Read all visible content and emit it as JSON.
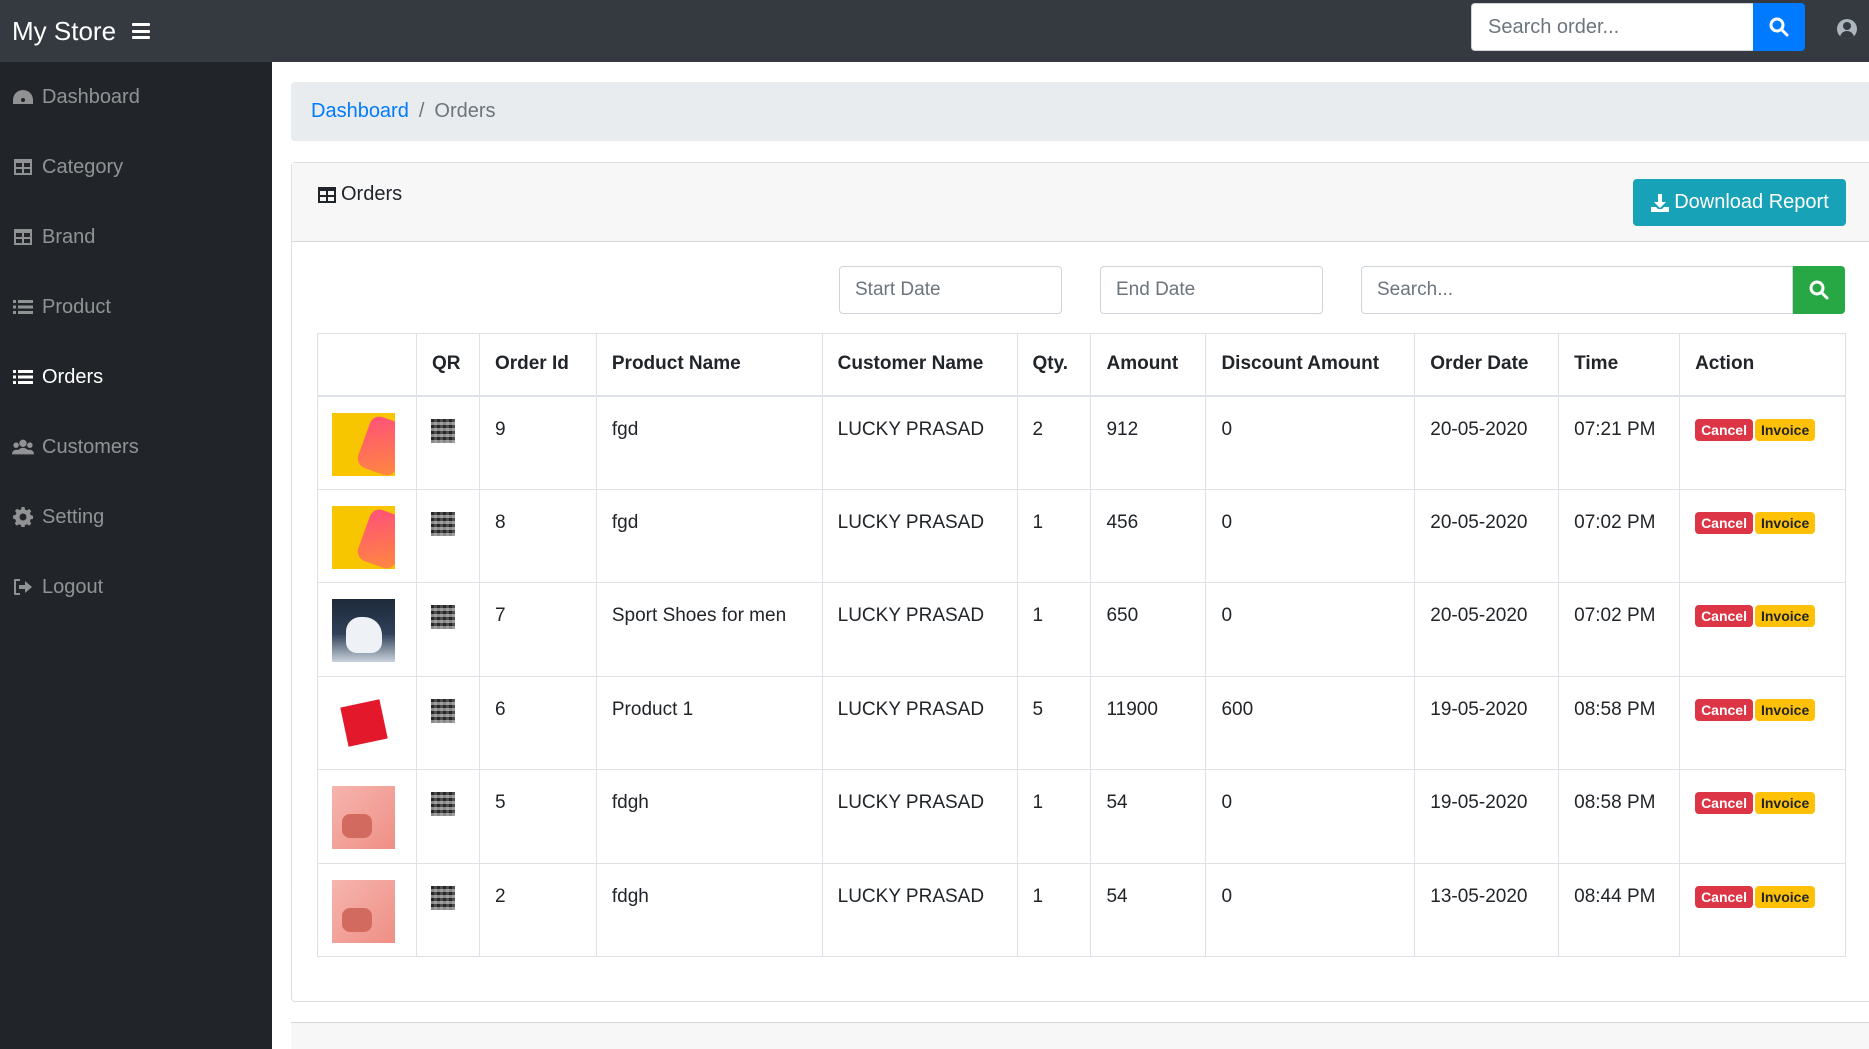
{
  "navbar": {
    "brand": "My Store",
    "search_placeholder": "Search order..."
  },
  "sidebar": {
    "items": [
      {
        "label": "Dashboard",
        "icon": "dashboard-icon"
      },
      {
        "label": "Category",
        "icon": "table-icon"
      },
      {
        "label": "Brand",
        "icon": "table-icon"
      },
      {
        "label": "Product",
        "icon": "list-icon"
      },
      {
        "label": "Orders",
        "icon": "list-icon",
        "active": true
      },
      {
        "label": "Customers",
        "icon": "users-icon"
      },
      {
        "label": "Setting",
        "icon": "gear-icon"
      },
      {
        "label": "Logout",
        "icon": "logout-icon"
      }
    ]
  },
  "breadcrumb": {
    "link": "Dashboard",
    "separator": "/",
    "current": "Orders"
  },
  "card": {
    "title": "Orders",
    "download_label": "Download Report"
  },
  "filters": {
    "start_placeholder": "Start Date",
    "end_placeholder": "End Date",
    "search_placeholder": "Search..."
  },
  "table": {
    "headers": [
      "",
      "QR",
      "Order Id",
      "Product Name",
      "Customer Name",
      "Qty.",
      "Amount",
      "Discount Amount",
      "Order Date",
      "Time",
      "Action"
    ],
    "rows": [
      {
        "order_id": "9",
        "product": "fgd",
        "customer": "LUCKY PRASAD",
        "qty": "2",
        "amount": "912",
        "discount": "0",
        "date": "20-05-2020",
        "time": "07:21 PM"
      },
      {
        "order_id": "8",
        "product": "fgd",
        "customer": "LUCKY PRASAD",
        "qty": "1",
        "amount": "456",
        "discount": "0",
        "date": "20-05-2020",
        "time": "07:02 PM"
      },
      {
        "order_id": "7",
        "product": "Sport Shoes for men",
        "customer": "LUCKY PRASAD",
        "qty": "1",
        "amount": "650",
        "discount": "0",
        "date": "20-05-2020",
        "time": "07:02 PM"
      },
      {
        "order_id": "6",
        "product": "Product 1",
        "customer": "LUCKY PRASAD",
        "qty": "5",
        "amount": "11900",
        "discount": "600",
        "date": "19-05-2020",
        "time": "08:58 PM"
      },
      {
        "order_id": "5",
        "product": "fdgh",
        "customer": "LUCKY PRASAD",
        "qty": "1",
        "amount": "54",
        "discount": "0",
        "date": "19-05-2020",
        "time": "08:58 PM"
      },
      {
        "order_id": "2",
        "product": "fdgh",
        "customer": "LUCKY PRASAD",
        "qty": "1",
        "amount": "54",
        "discount": "0",
        "date": "13-05-2020",
        "time": "08:44 PM"
      }
    ],
    "cancel_label": "Cancel",
    "invoice_label": "Invoice"
  },
  "colors": {
    "navbar": "#343a40",
    "sidebar": "#212529",
    "primary": "#007bff",
    "info": "#17a2b8",
    "success": "#28a745",
    "danger": "#dc3545",
    "warning": "#ffc107"
  }
}
